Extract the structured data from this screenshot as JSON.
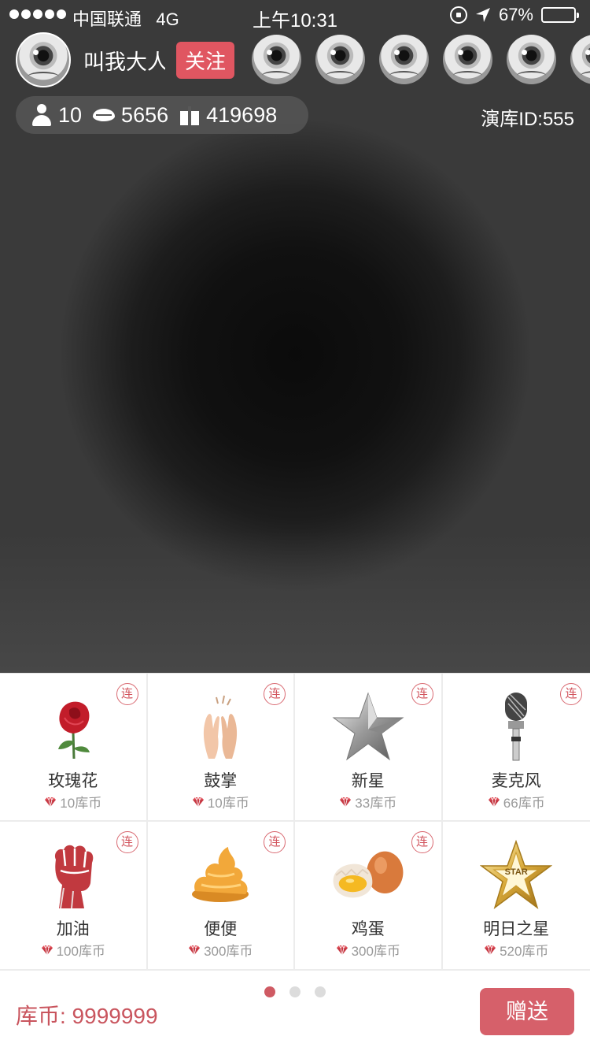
{
  "status_bar": {
    "carrier": "中国联通",
    "network": "4G",
    "time": "上午10:31",
    "battery": "67%",
    "battery_level": 0.67
  },
  "host": {
    "name": "叫我大人",
    "follow_label": "关注"
  },
  "viewers": [
    "eye-avatar",
    "eye-avatar",
    "eye-avatar",
    "eye-avatar",
    "eye-avatar",
    "eye-avatar"
  ],
  "stats": {
    "audience": "10",
    "likes": "5656",
    "gifts": "419698"
  },
  "room": {
    "id_label": "演库ID:555"
  },
  "gifts": [
    {
      "name": "玫瑰花",
      "price": "10库币",
      "combo": "连",
      "icon": "rose-icon"
    },
    {
      "name": "鼓掌",
      "price": "10库币",
      "combo": "连",
      "icon": "clapping-hands-icon"
    },
    {
      "name": "新星",
      "price": "33库币",
      "combo": "连",
      "icon": "silver-star-icon"
    },
    {
      "name": "麦克风",
      "price": "66库币",
      "combo": "连",
      "icon": "microphone-icon"
    },
    {
      "name": "加油",
      "price": "100库币",
      "combo": "连",
      "icon": "fist-icon"
    },
    {
      "name": "便便",
      "price": "300库币",
      "combo": "连",
      "icon": "poop-icon"
    },
    {
      "name": "鸡蛋",
      "price": "300库币",
      "combo": "连",
      "icon": "eggs-icon"
    },
    {
      "name": "明日之星",
      "price": "520库币",
      "combo": "",
      "icon": "gold-star-icon",
      "badge": "STAR"
    }
  ],
  "footer": {
    "coins": "库币: 9999999",
    "send_label": "赠送",
    "pages": 3,
    "current_page": 1
  },
  "colors": {
    "accent": "#d6606a",
    "follow": "#e05661"
  }
}
